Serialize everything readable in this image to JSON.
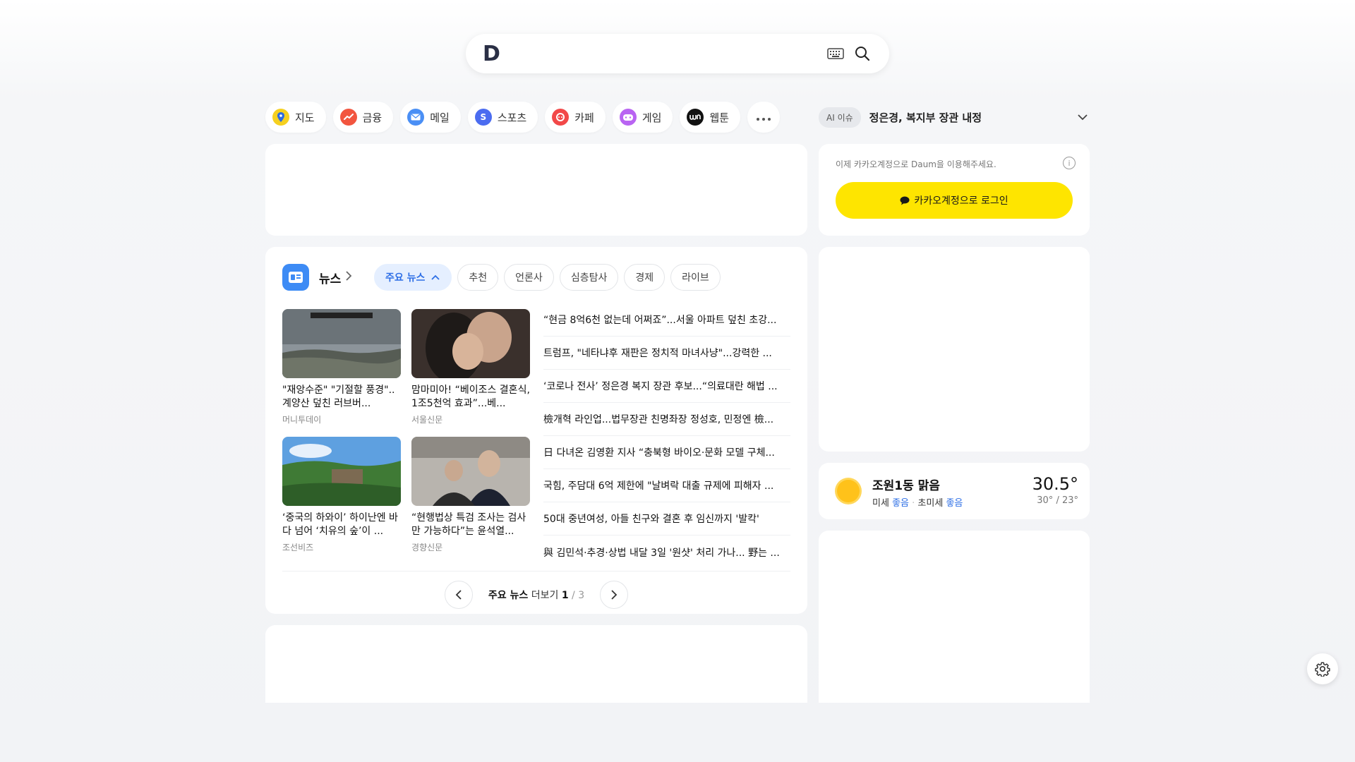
{
  "search": {
    "logo": "D",
    "placeholder": ""
  },
  "services": [
    {
      "label": "지도",
      "icon": "map-pin-icon",
      "color": "#f5d020"
    },
    {
      "label": "금융",
      "icon": "finance-icon",
      "color": "#f2553f"
    },
    {
      "label": "메일",
      "icon": "mail-icon",
      "color": "#4a8ff5"
    },
    {
      "label": "스포츠",
      "icon": "sports-icon",
      "color": "#4b6cf0"
    },
    {
      "label": "카페",
      "icon": "cafe-icon",
      "color": "#f24848"
    },
    {
      "label": "게임",
      "icon": "game-icon",
      "color": "#b964f2"
    },
    {
      "label": "웹툰",
      "icon": "webtoon-icon",
      "color": "#111111"
    }
  ],
  "ai_issue": {
    "badge": "AI 이슈",
    "text": "정은경, 복지부 장관 내정"
  },
  "login": {
    "note": "이제 카카오계정으로 Daum을 이용해주세요.",
    "button": "카카오계정으로 로그인"
  },
  "news": {
    "title": "뉴스",
    "tabs": [
      "주요 뉴스",
      "추천",
      "언론사",
      "심층탐사",
      "경제",
      "라이브"
    ],
    "thumbs": [
      {
        "title": "\"재앙수준\" \"기절할 풍경\"..계양산 덮친 러브버...",
        "source": "머니투데이"
      },
      {
        "title": "맘마미아! “베이조스 결혼식, 1조5천억 효과”...베...",
        "source": "서울신문"
      },
      {
        "title": "‘중국의 하와이’ 하이난엔 바다 넘어 ‘치유의 숲’이 ...",
        "source": "조선비즈"
      },
      {
        "title": "“현행법상 특검 조사는 검사만 가능하다”는 윤석열...",
        "source": "경향신문"
      }
    ],
    "headlines": [
      "“현금 8억6천 없는데 어쩌죠”...서울 아파트 덮친 초강...",
      "트럼프, \"네타냐후 재판은 정치적 마녀사냥\"...강력한 ...",
      "‘코로나 전사’ 정은경 복지 장관 후보...“의료대란 해법 ...",
      "檢개혁 라인업...법무장관 친명좌장 정성호, 민정엔 檢...",
      "日 다녀온 김영환 지사 “충북형 바이오·문화 모델 구체...",
      "국힘, 주담대 6억 제한에 \"날벼락 대출 규제에 피해자 ...",
      "50대 중년여성, 아들 친구와 결혼 후 임신까지 '발칵'",
      "與 김민석·추경·상법 내달 3일 '원샷' 처리 가나... 野는 ..."
    ],
    "pager": {
      "label": "주요 뉴스",
      "more": "더보기",
      "current": "1",
      "sep": "/",
      "total": "3"
    }
  },
  "weather": {
    "location": "조원1동 맑음",
    "fine_dust_label": "미세",
    "fine_dust_value": "좋음",
    "ultrafine_label": "초미세",
    "ultrafine_value": "좋음",
    "temp": "30.5°",
    "range": "30° / 23°"
  }
}
